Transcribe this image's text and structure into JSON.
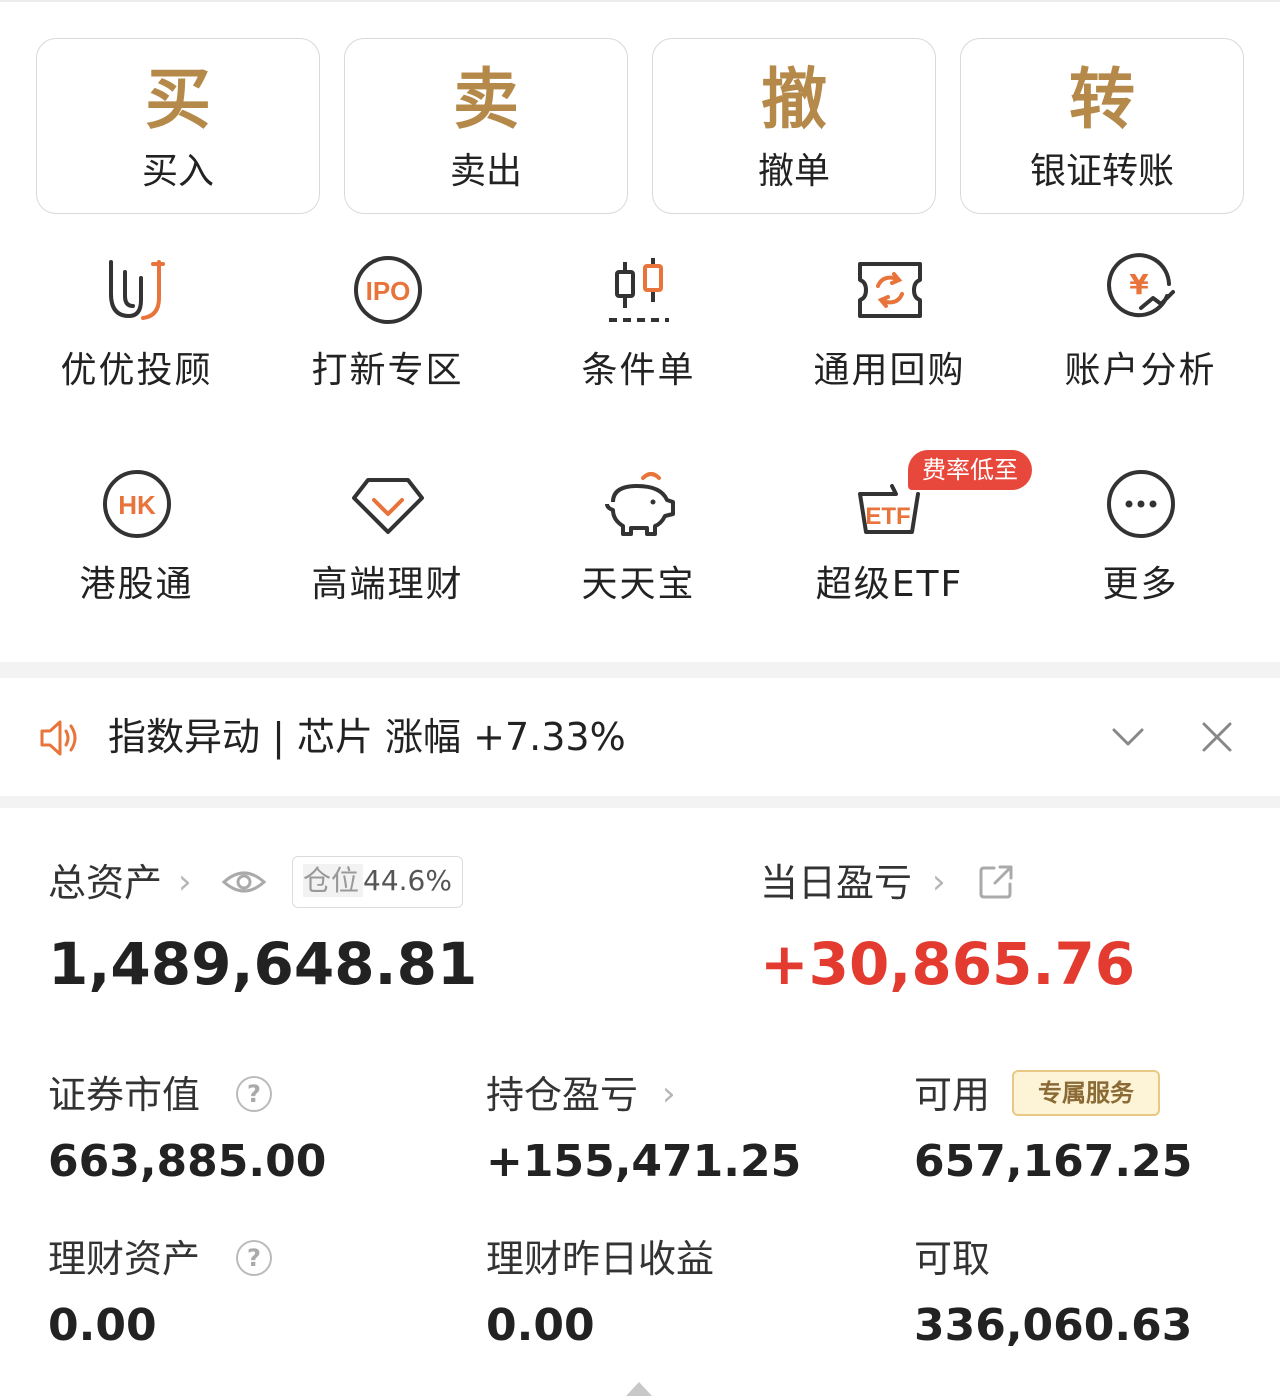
{
  "quick_actions": [
    {
      "glyph": "买",
      "label": "买入"
    },
    {
      "glyph": "卖",
      "label": "卖出"
    },
    {
      "glyph": "撤",
      "label": "撤单"
    },
    {
      "glyph": "转",
      "label": "银证转账"
    }
  ],
  "services_row1": [
    {
      "label": "优优投顾",
      "icon": "uu-advisor-icon"
    },
    {
      "label": "打新专区",
      "icon": "ipo-icon",
      "icon_text": "IPO"
    },
    {
      "label": "条件单",
      "icon": "candlestick-icon"
    },
    {
      "label": "通用回购",
      "icon": "repo-ticket-icon"
    },
    {
      "label": "账户分析",
      "icon": "yen-analysis-icon",
      "icon_text": "¥"
    }
  ],
  "services_row2": [
    {
      "label": "港股通",
      "icon": "hk-icon",
      "icon_text": "HK"
    },
    {
      "label": "高端理财",
      "icon": "diamond-icon"
    },
    {
      "label": "天天宝",
      "icon": "piggy-bank-icon"
    },
    {
      "label": "超级ETF",
      "icon": "etf-basket-icon",
      "icon_text": "ETF",
      "badge": "费率低至"
    },
    {
      "label": "更多",
      "icon": "more-icon"
    }
  ],
  "notice": {
    "text": "指数异动 | 芯片 涨幅 +7.33%"
  },
  "assets": {
    "total_label": "总资产",
    "position_key": "仓位",
    "position_value": "44.6%",
    "total_value": "1,489,648.81",
    "daily_pnl_label": "当日盈亏",
    "daily_pnl_value": "+30,865.76",
    "securities_label": "证券市值",
    "securities_value": "663,885.00",
    "holding_pnl_label": "持仓盈亏",
    "holding_pnl_value": "+155,471.25",
    "available_label": "可用",
    "available_tag": "专属服务",
    "available_value": "657,167.25",
    "wealth_label": "理财资产",
    "wealth_value": "0.00",
    "wealth_yesterday_label": "理财昨日收益",
    "wealth_yesterday_value": "0.00",
    "withdrawable_label": "可取",
    "withdrawable_value": "336,060.63"
  },
  "colors": {
    "gold": "#b5894a",
    "red": "#e33b2f",
    "orange_icon": "#e8743b",
    "badge_red": "#e8473c"
  }
}
